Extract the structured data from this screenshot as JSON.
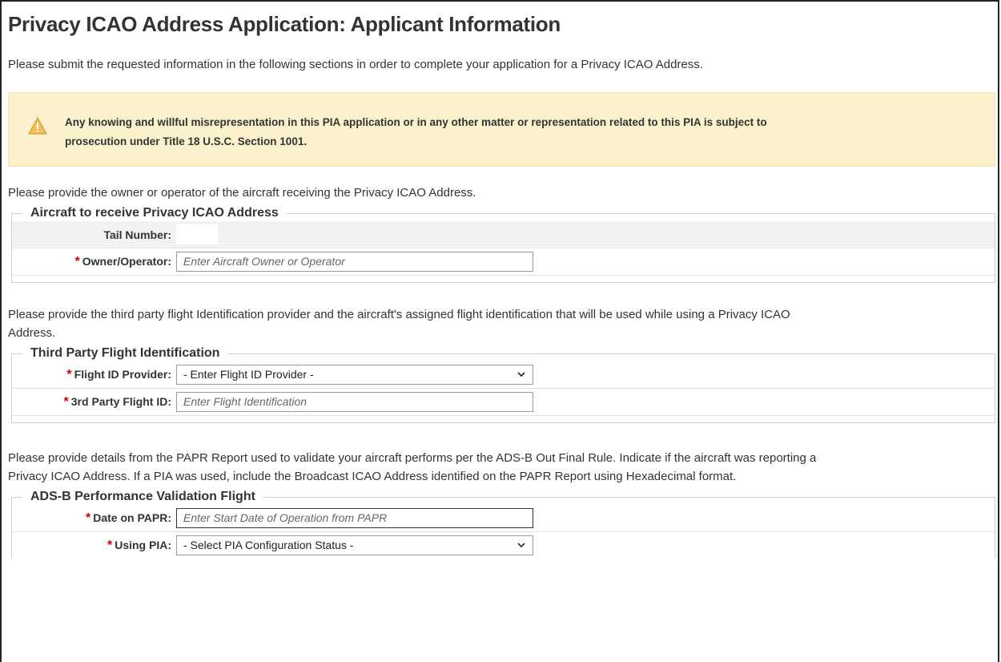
{
  "page": {
    "title": "Privacy ICAO Address Application: Applicant Information",
    "intro": "Please submit the requested information in the following sections in order to complete your application for a Privacy ICAO Address."
  },
  "warning": {
    "icon": "warning-triangle-icon",
    "line1": "Any knowing and willful misrepresentation in this PIA application or in any other matter or representation related to this PIA is subject to",
    "line2": "prosecution under Title 18 U.S.C. Section 1001."
  },
  "aircraft": {
    "description": "Please provide the owner or operator of the aircraft receiving the Privacy ICAO Address.",
    "legend": "Aircraft to receive Privacy ICAO Address",
    "tail_label": "Tail Number:",
    "tail_value": "",
    "owner_label": "Owner/Operator:",
    "owner_placeholder": "Enter Aircraft Owner or Operator"
  },
  "third_party": {
    "description_line1": "Please provide the third party flight Identification provider and the aircraft's assigned flight identification that will be used while using a Privacy ICAO",
    "description_line2": "Address.",
    "legend": "Third Party Flight Identification",
    "provider_label": "Flight ID Provider:",
    "provider_selected": "- Enter Flight ID Provider -",
    "flight_id_label": "3rd Party Flight ID:",
    "flight_id_placeholder": "Enter Flight Identification"
  },
  "adsb": {
    "description_line1": "Please provide details from the PAPR Report used to validate your aircraft performs per the ADS-B Out Final Rule. Indicate if the aircraft was reporting a",
    "description_line2": "Privacy ICAO Address. If a PIA was used, include the Broadcast ICAO Address identified on the PAPR Report using Hexadecimal format.",
    "legend": "ADS-B Performance Validation Flight",
    "date_label": "Date on PAPR:",
    "date_placeholder": "Enter Start Date of Operation from PAPR",
    "pia_label": "Using PIA:",
    "pia_selected": "- Select PIA Configuration Status -"
  },
  "required_marker": "*",
  "colors": {
    "warning_bg": "#fcf1cd",
    "required": "#cc0000",
    "row_shade": "#f2f2f2"
  }
}
